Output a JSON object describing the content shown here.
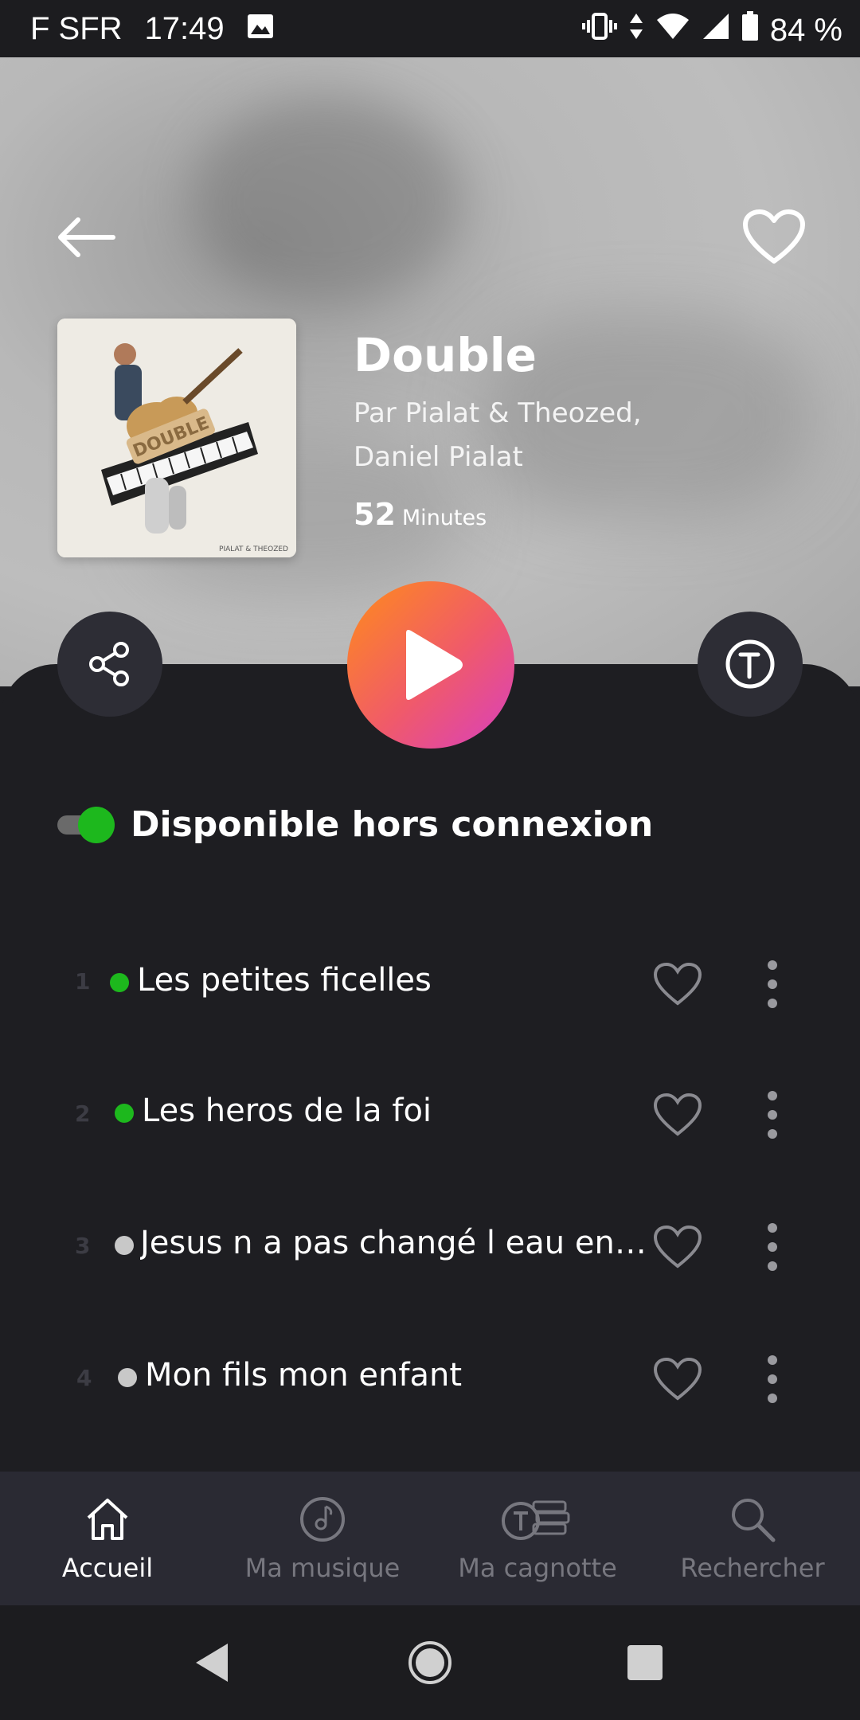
{
  "status_bar": {
    "carrier": "F SFR",
    "time": "17:49",
    "battery": "84 %"
  },
  "album": {
    "title": "Double",
    "artist": "Par Pialat & Theozed, Daniel Pialat",
    "duration_value": "52",
    "duration_unit": "Minutes",
    "cover_text": "DOUBLE",
    "cover_caption": "PIALAT & THEOZED"
  },
  "offline": {
    "label": "Disponible hors connexion",
    "enabled": true
  },
  "tracks": [
    {
      "number": "1",
      "title": "Les petites ficelles",
      "downloaded": true
    },
    {
      "number": "2",
      "title": "Les heros de la foi",
      "downloaded": true
    },
    {
      "number": "3",
      "title": "Jesus n a pas changé l eau en v...",
      "downloaded": false
    },
    {
      "number": "4",
      "title": "Mon fils mon enfant",
      "downloaded": false
    }
  ],
  "colors": {
    "accent_green": "#1db81d",
    "inactive_dot": "#c8c8c8",
    "play_gradient_start": "#ff8c1a",
    "play_gradient_end": "#d83fc0"
  },
  "nav": {
    "items": [
      {
        "label": "Accueil",
        "icon": "home-icon",
        "active": true
      },
      {
        "label": "Ma musique",
        "icon": "music-disc-icon",
        "active": false
      },
      {
        "label": "Ma cagnotte",
        "icon": "coins-icon",
        "active": false
      },
      {
        "label": "Rechercher",
        "icon": "search-icon",
        "active": false
      }
    ]
  }
}
